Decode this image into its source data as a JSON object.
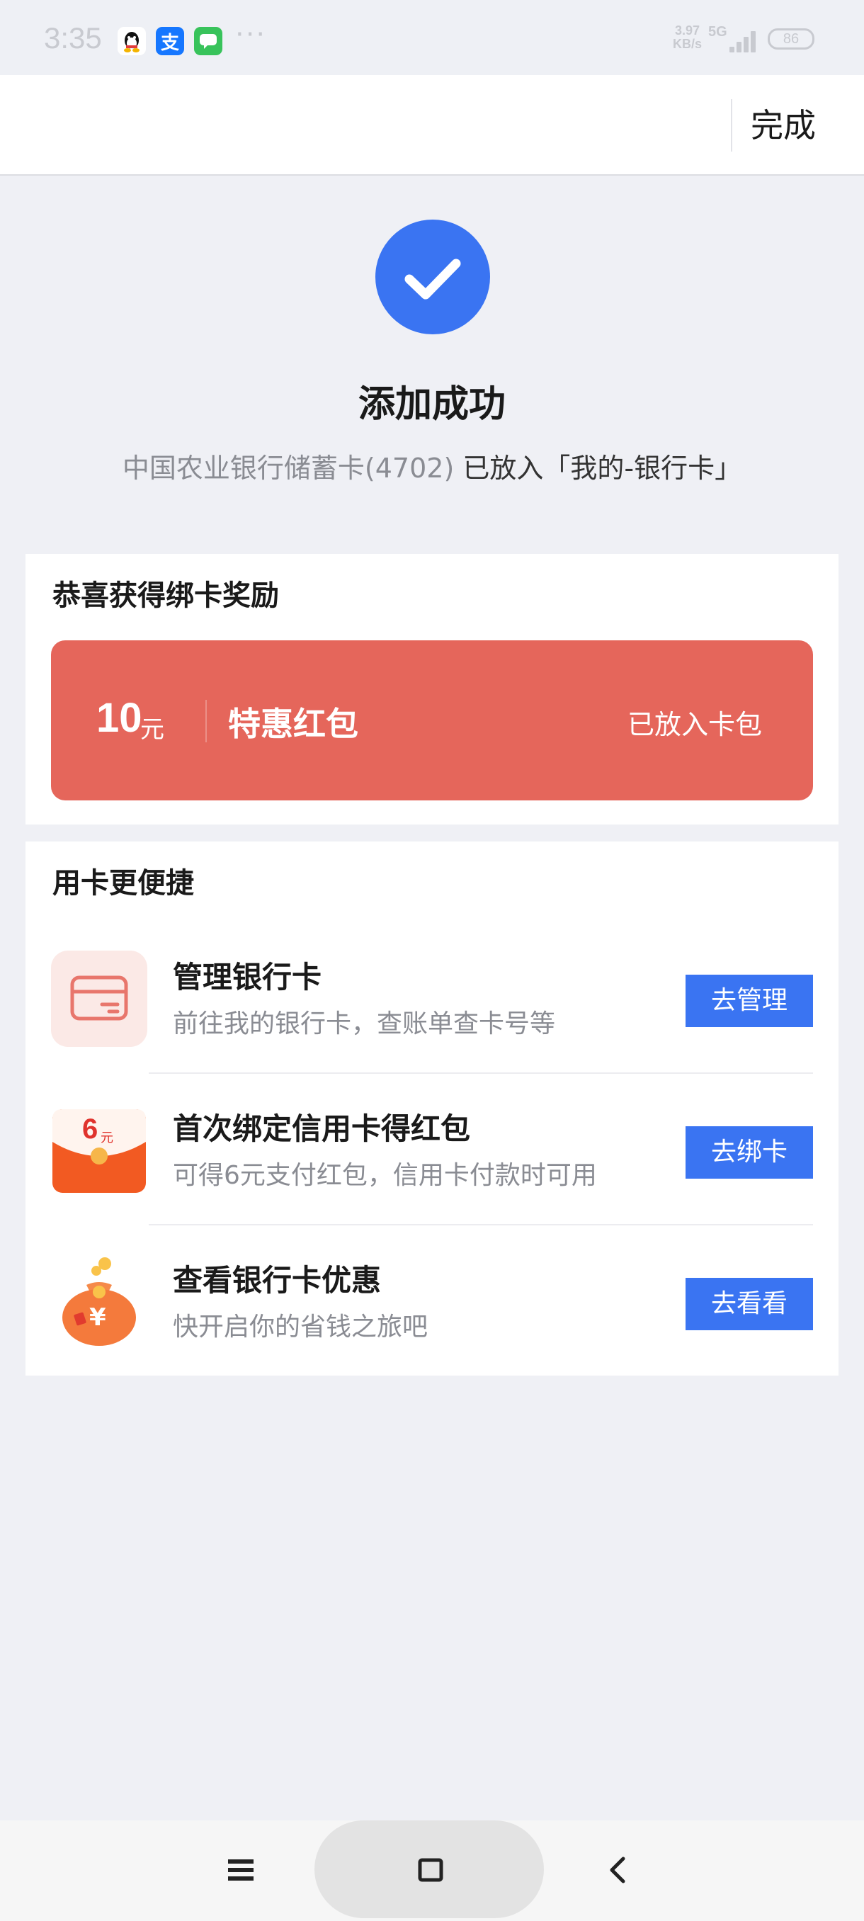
{
  "status_bar": {
    "time": "3:35",
    "apps": [
      {
        "name": "qq-icon",
        "glyph": "",
        "color": "#ffffff"
      },
      {
        "name": "alipay-icon",
        "glyph": "支",
        "color": "#1677ff"
      },
      {
        "name": "messages-icon",
        "glyph": "",
        "color": "#38c35b"
      }
    ],
    "more": "···",
    "net_speed_value": "3.97",
    "net_speed_unit": "KB/s",
    "network": "5G",
    "battery": "86"
  },
  "top_bar": {
    "done_label": "完成"
  },
  "success": {
    "title": "添加成功",
    "card_name": "中国农业银行储蓄卡(4702)",
    "placed_text": " 已放入「我的-银行卡」",
    "accent_color": "#3a74f2"
  },
  "reward": {
    "title": "恭喜获得绑卡奖励",
    "amount": "10",
    "unit": "元",
    "name": "特惠红包",
    "status": "已放入卡包",
    "color": "#e5665b"
  },
  "convenience": {
    "title": "用卡更便捷",
    "items": [
      {
        "icon": "bank-card-icon",
        "title": "管理银行卡",
        "subtitle": "前往我的银行卡，查账单查卡号等",
        "button": "去管理"
      },
      {
        "icon": "red-envelope-icon",
        "title": "首次绑定信用卡得红包",
        "subtitle": "可得6元支付红包，信用卡付款时可用",
        "button": "去绑卡",
        "badge_amount": "6",
        "badge_unit": "元"
      },
      {
        "icon": "money-bag-icon",
        "title": "查看银行卡优惠",
        "subtitle": "快开启你的省钱之旅吧",
        "button": "去看看",
        "badge_symbol": "¥"
      }
    ]
  },
  "nav_bar": {
    "buttons": [
      "menu-icon",
      "home-icon",
      "back-icon"
    ]
  }
}
